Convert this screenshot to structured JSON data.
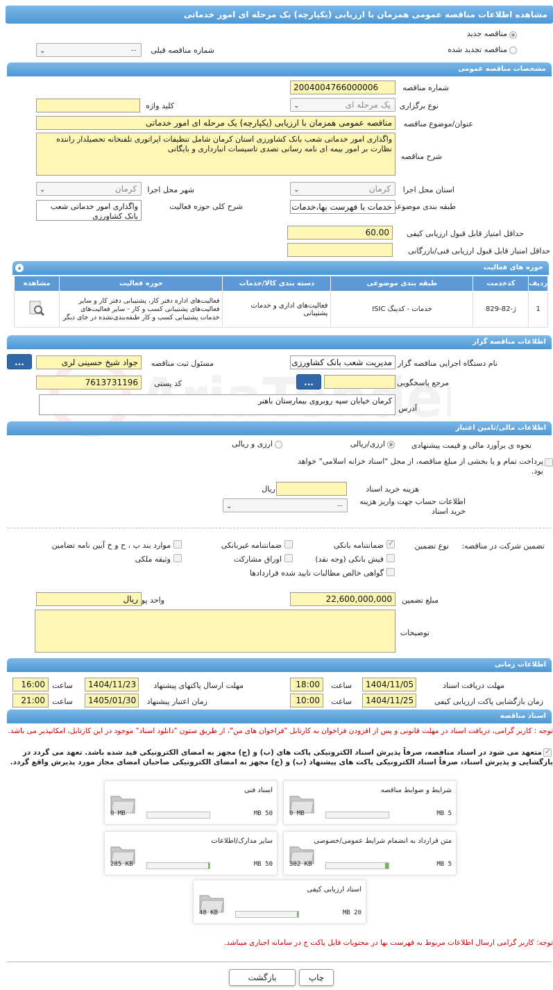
{
  "header": {
    "title": "مشاهده اطلاعات مناقصه عمومی همزمان با ارزیابی (یکپارچه) یک مرحله ای امور خدماتی"
  },
  "tender_type": {
    "new_label": "مناقصه جدید",
    "renewed_label": "مناقصه تجدید شده",
    "prev_label": "شماره مناقصه قبلی",
    "prev_value": "--"
  },
  "general": {
    "section": "مشخصات مناقصه عمومی",
    "number_label": "شماره مناقصه",
    "number": "2004004766000006",
    "hold_label": "نوع برگزاری",
    "hold": "یک مرحله ای",
    "keyword_label": "کلید واژه",
    "keyword": "",
    "subject_label": "عنوان/موضوع مناقصه",
    "subject": "مناقصه عمومی همزمان با ارزیابی (یکپارچه) یک مرحله ای امور خدماتی",
    "desc_label": "شرح مناقصه",
    "desc": "واگذاری امور خدماتی شعب بانک کشاورزی استان کرمان شامل تنظیفات اپراتوری تلفنخانه تحصیلدار راننده نظارت بر امور بیمه ای نامه رسانی تصدی تاسیسات انبارداری و بایگانی",
    "province_label": "استان محل اجرا",
    "province": "کرمان",
    "city_label": "شهر محل اجرا",
    "city": "کرمان",
    "category_label": "طبقه بندی موضوعی",
    "category": "خدمات با فهرست بها،خدمات",
    "activity_label": "شرح کلی حوزه فعالیت",
    "activity": "واگذاری امور خدماتی شعب بانک کشاورزی",
    "min_quality_label": "حداقل امتیاز قابل قبول ارزیابی کیفی",
    "min_quality": "60.00",
    "min_tech_label": "حداقل امتیاز قابل قبول ارزیابی فنی/بازرگانی",
    "min_tech": ""
  },
  "activities": {
    "section": "حوزه های فعالیت",
    "headers": [
      "ردیف",
      "کدخدمت",
      "طبقه بندی موضوعی",
      "دسته بندی کالا/خدمات",
      "حوزه فعالیت",
      "مشاهده"
    ],
    "rows": [
      {
        "idx": "1",
        "code": "ژ-82-829",
        "cat": "خدمات - کدینگ ISIC",
        "group": "فعالیت‌های اداری و خدمات پشتیبانی",
        "area": "فعالیت‌های اداره دفتر کار، پشتیبانی دفتر کار و سایر فعالیت‌های پشتیبانی کسب و کار - سایر فعالیت‌های خدمات پشتیبانی کسب و کار طبقه‌بندی‌نشده در جای دیگر"
      }
    ]
  },
  "organizer": {
    "section": "اطلاعات مناقصه گزار",
    "device_label": "نام دستگاه اجرایی مناقصه گزار",
    "device": "مدیریت شعب بانک کشاورزی",
    "official_label": "مسئول ثبت مناقصه",
    "official": "جواد شیخ حسینی لری",
    "ref_label": "مرجع پاسخگویی",
    "ref": "",
    "postal_label": "کد پستی",
    "postal": "7613731196",
    "address_label": "آدرس",
    "address": "کرمان خیابان سپه  روبروی بیمارستان باهنر",
    "more": "..."
  },
  "finance": {
    "section": "اطلاعات مالی/تامین اعتبار",
    "estimate_label": "نحوه ی برآورد مالی و قیمت پیشنهادی",
    "opt1": "ارزی/ریالی",
    "opt2": "ارزی و ریالی",
    "treasury": "پرداخت تمام و یا بخشی از مبلغ مناقصه، از محل \"اسناد خزانه اسلامی\" خواهد بود.",
    "doc_cost_label": "هزینه خرید اسناد",
    "doc_cost": "",
    "doc_cost_unit": "ریال",
    "account_label": "اطلاعات حساب جهت واریز هزینه خرید اسناد",
    "account": "--"
  },
  "guarantee": {
    "participation_label": "تضمین شرکت در مناقصه:",
    "type_label": "نوع تضمین",
    "options": [
      "ضمانتنامه بانکی",
      "ضمانتنامه غیربانکی",
      "موارد بند پ ، ح و خ آیین نامه تضامین",
      "فیش بانکی (وجه نقد)",
      "اوراق مشارکت",
      "وثیقه ملکی",
      "گواهی خالص مطالبات تایید شده قراردادها"
    ],
    "amount_label": "مبلغ تضمین",
    "amount": "22,600,000,000",
    "unit_label": "واحد پول",
    "unit": "ریال",
    "notes_label": "توضیحات",
    "notes": ""
  },
  "timing": {
    "section": "اطلاعات زمانی",
    "receive_label": "مهلت دریافت اسناد",
    "receive_date": "1404/11/05",
    "receive_time": "18:00",
    "send_label": "مهلت ارسال پاکتهای پیشنهاد",
    "send_date": "1404/11/23",
    "send_time": "16:00",
    "open_label": "زمان بازگشایی پاکت ارزیابی کیفی",
    "open_date": "1404/11/25",
    "open_time": "10:00",
    "valid_label": "زمان اعتبار پیشنهاد",
    "valid_date": "1405/01/30",
    "valid_time": "21:00",
    "time_label": "ساعت"
  },
  "docs": {
    "section": "اسناد مناقصه",
    "note1": "توجه : کاربر گرامی، دریافت اسناد در مهلت قانونی و پس از افزودن فراخوان به کارتابل \"فراخوان های من\"، از طریق ستون \"دانلود اسناد\" موجود در این کارتابل، امکانپذیر می باشد.",
    "commit": "متعهد می شود در اسناد مناقصه، صرفاً پذیرش اسناد الکترونیکی پاکت های (ب) و (ج) مجهز به امضای الکترونیکی قید شده باشد. تعهد می گردد در بازگشایی و پذیرش اسناد، صرفاً اسناد الکترونیکی پاکت های پیشنهاد (ب) و (ج) مجهز به امضای الکترونیکی صاحبان امضای مجاز مورد پذیرش واقع گردد.",
    "files": [
      {
        "title": "شرایط و ضوابط مناقصه",
        "max": "5 MB",
        "cur": "0 MB",
        "fill": 0
      },
      {
        "title": "اسناد فنی",
        "max": "50 MB",
        "cur": "0 MB",
        "fill": 0
      },
      {
        "title": "متن قرارداد به انضمام شرایط عمومی/خصوصی",
        "max": "5 MB",
        "cur": "302 KB",
        "fill": 0.06
      },
      {
        "title": "سایر مدارک/اطلاعات",
        "max": "50 MB",
        "cur": "285 KB",
        "fill": 0.006
      },
      {
        "title": "اسناد ارزیابی کیفی",
        "max": "20 MB",
        "cur": "48 KB",
        "fill": 0.003
      }
    ],
    "note2": "توجه: کاربر گرامی ارسال اطلاعات مربوط به فهرست بها در محتویات فایل پاکت ج در سامانه اجباری میباشد."
  },
  "actions": {
    "print": "چاپ",
    "back": "بازگشت"
  },
  "colors": {
    "header": "#5aa2dc",
    "field": "#fdf7b3",
    "button": "#2f67a8",
    "note": "#d00000"
  },
  "watermark": "AriaTender.neT"
}
